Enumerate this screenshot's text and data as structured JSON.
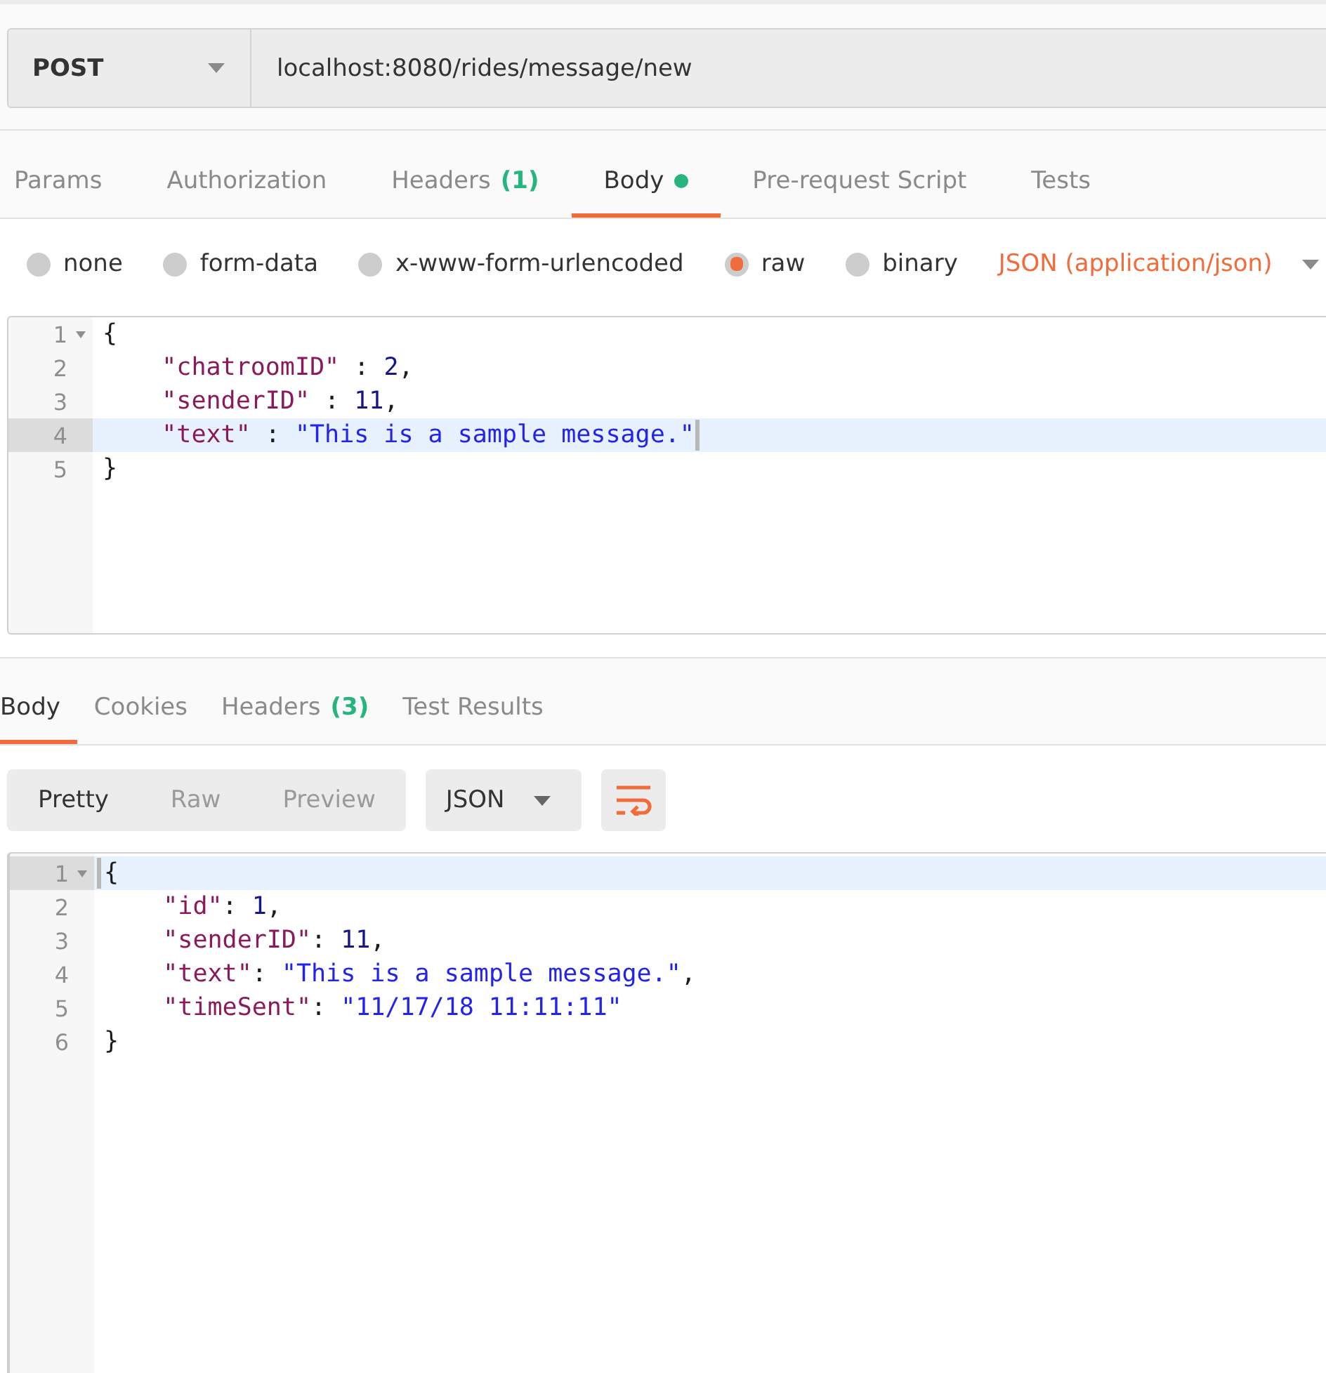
{
  "request_bar": {
    "method": "POST",
    "url": "localhost:8080/rides/message/new"
  },
  "request_tabs": [
    {
      "label": "Params",
      "selected": false,
      "dot": false
    },
    {
      "label": "Authorization",
      "selected": false,
      "dot": false
    },
    {
      "label": "Headers",
      "count": "(1)",
      "selected": false,
      "dot": false
    },
    {
      "label": "Body",
      "selected": true,
      "dot": true
    },
    {
      "label": "Pre-request Script",
      "selected": false,
      "dot": false
    },
    {
      "label": "Tests",
      "selected": false,
      "dot": false
    }
  ],
  "body_types": {
    "options": [
      {
        "label": "none",
        "selected": false
      },
      {
        "label": "form-data",
        "selected": false
      },
      {
        "label": "x-www-form-urlencoded",
        "selected": false
      },
      {
        "label": "raw",
        "selected": true
      },
      {
        "label": "binary",
        "selected": false
      }
    ],
    "format": "JSON (application/json)"
  },
  "request_editor": {
    "lines": [
      {
        "number": "1",
        "active": false,
        "tokens": [
          {
            "kind": "punct",
            "text": "{"
          }
        ],
        "children": [
          {
            "number": "2",
            "active": false,
            "tokens": [
              {
                "kind": "key",
                "text": "\"chatroomID\""
              },
              {
                "kind": "punct",
                "text": " : "
              },
              {
                "kind": "number",
                "text": "2"
              },
              {
                "kind": "punct",
                "text": ","
              }
            ]
          },
          {
            "number": "3",
            "active": false,
            "tokens": [
              {
                "kind": "key",
                "text": "\"senderID\""
              },
              {
                "kind": "punct",
                "text": " : "
              },
              {
                "kind": "number",
                "text": "11"
              },
              {
                "kind": "punct",
                "text": ","
              }
            ]
          },
          {
            "number": "4",
            "active": true,
            "tokens": [
              {
                "kind": "key",
                "text": "\"text\""
              },
              {
                "kind": "punct",
                "text": " : "
              },
              {
                "kind": "string",
                "text": "\"This is a sample message.\""
              },
              {
                "kind": "cursor"
              }
            ]
          }
        ]
      },
      {
        "number": "5",
        "active": false,
        "tokens": [
          {
            "kind": "punct",
            "text": "}"
          }
        ]
      }
    ]
  },
  "response_tabs": [
    {
      "label": "Body",
      "selected": true
    },
    {
      "label": "Cookies",
      "selected": false
    },
    {
      "label": "Headers",
      "count": "(3)",
      "selected": false
    },
    {
      "label": "Test Results",
      "selected": false
    }
  ],
  "response_view": {
    "modes": [
      {
        "label": "Pretty",
        "selected": true
      },
      {
        "label": "Raw",
        "selected": false
      },
      {
        "label": "Preview",
        "selected": false
      }
    ],
    "format": "JSON"
  },
  "response_editor": {
    "lines": [
      {
        "number": "1",
        "active": true,
        "tokens": [
          {
            "kind": "cursor"
          },
          {
            "kind": "punct",
            "text": "{"
          }
        ],
        "children": [
          {
            "number": "2",
            "active": false,
            "tokens": [
              {
                "kind": "key",
                "text": "\"id\""
              },
              {
                "kind": "punct",
                "text": ": "
              },
              {
                "kind": "number",
                "text": "1"
              },
              {
                "kind": "punct",
                "text": ","
              }
            ]
          },
          {
            "number": "3",
            "active": false,
            "tokens": [
              {
                "kind": "key",
                "text": "\"senderID\""
              },
              {
                "kind": "punct",
                "text": ": "
              },
              {
                "kind": "number",
                "text": "11"
              },
              {
                "kind": "punct",
                "text": ","
              }
            ]
          },
          {
            "number": "4",
            "active": false,
            "tokens": [
              {
                "kind": "key",
                "text": "\"text\""
              },
              {
                "kind": "punct",
                "text": ": "
              },
              {
                "kind": "string",
                "text": "\"This is a sample message.\""
              },
              {
                "kind": "punct",
                "text": ","
              }
            ]
          },
          {
            "number": "5",
            "active": false,
            "tokens": [
              {
                "kind": "key",
                "text": "\"timeSent\""
              },
              {
                "kind": "punct",
                "text": ": "
              },
              {
                "kind": "string",
                "text": "\"11/17/18 11:11:11\""
              }
            ]
          }
        ]
      },
      {
        "number": "6",
        "active": false,
        "tokens": [
          {
            "kind": "punct",
            "text": "}"
          }
        ]
      }
    ]
  }
}
